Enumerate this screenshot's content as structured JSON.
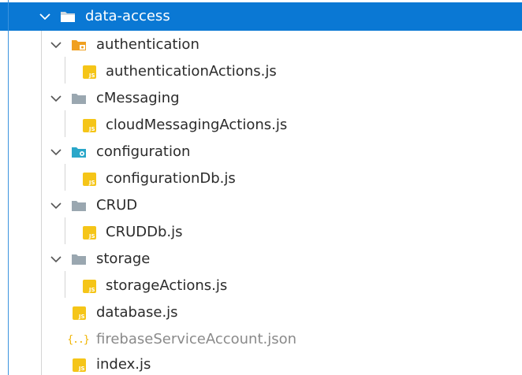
{
  "tree": {
    "root": {
      "label": "data-access",
      "expanded": true,
      "selected": true
    },
    "items": [
      {
        "label": "authentication",
        "kind": "folder",
        "icon": "folder-auth-icon"
      },
      {
        "label": "authenticationActions.js",
        "kind": "js"
      },
      {
        "label": "cMessaging",
        "kind": "folder",
        "icon": "folder-icon"
      },
      {
        "label": "cloudMessagingActions.js",
        "kind": "js"
      },
      {
        "label": "configuration",
        "kind": "folder",
        "icon": "folder-config-icon"
      },
      {
        "label": "configurationDb.js",
        "kind": "js"
      },
      {
        "label": "CRUD",
        "kind": "folder",
        "icon": "folder-icon"
      },
      {
        "label": "CRUDDb.js",
        "kind": "js"
      },
      {
        "label": "storage",
        "kind": "folder",
        "icon": "folder-icon"
      },
      {
        "label": "storageActions.js",
        "kind": "js"
      },
      {
        "label": "database.js",
        "kind": "js"
      },
      {
        "label": "firebaseServiceAccount.json",
        "kind": "json",
        "badge": "{..}"
      },
      {
        "label": "index.js",
        "kind": "js"
      }
    ],
    "js_badge_text": "JS"
  },
  "colors": {
    "selection": "#0a78d4",
    "js_icon": "#f5c518",
    "json_icon": "#f0b400",
    "folder_gray": "#9aa7b0",
    "folder_auth": "#f0a020",
    "folder_config": "#2aa7c9",
    "dim_text": "#8a8a8a"
  }
}
